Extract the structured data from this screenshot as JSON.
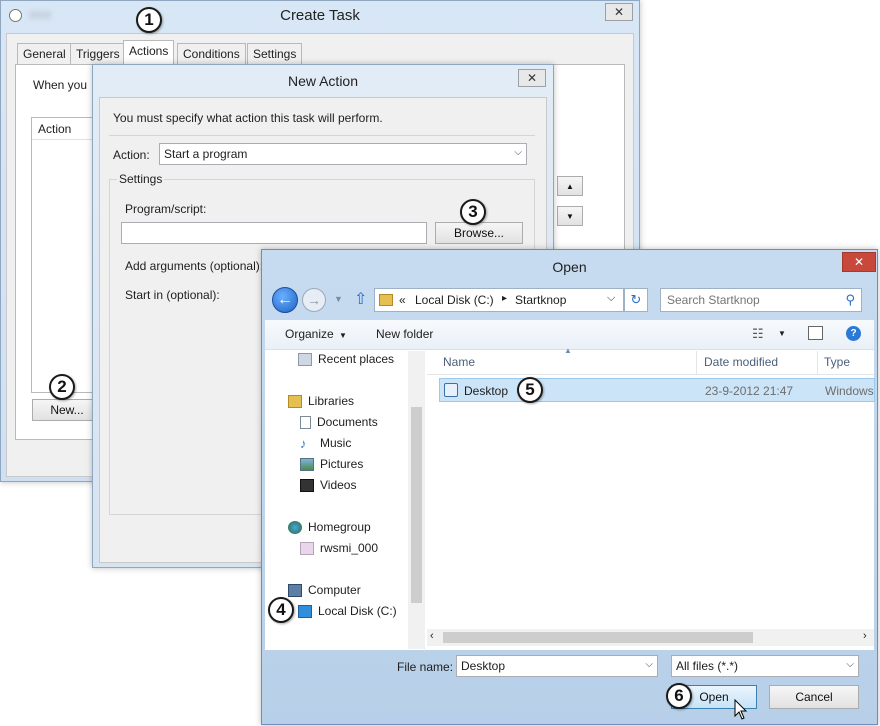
{
  "create_task": {
    "title": "Create Task",
    "close": "✕",
    "tabs": [
      "General",
      "Triggers",
      "Actions",
      "Conditions",
      "Settings"
    ],
    "intro_text": "When you",
    "column_action": "Action",
    "new_button": "New...",
    "up_arrow": "▲",
    "down_arrow": "▼"
  },
  "new_action": {
    "title": "New Action",
    "close": "✕",
    "instruction": "You must specify what action this task will perform.",
    "action_label": "Action:",
    "action_value": "Start a program",
    "settings_label": "Settings",
    "program_label": "Program/script:",
    "browse_button": "Browse...",
    "args_label": "Add arguments (optional):",
    "startin_label": "Start in (optional):"
  },
  "open_dialog": {
    "title": "Open",
    "close": "✕",
    "path_prefix": "«",
    "path_drive": "Local Disk (C:)",
    "path_sep": "▸",
    "path_folder": "Startknop",
    "search_placeholder": "Search Startknop",
    "organize": "Organize",
    "organize_arrow": "▼",
    "new_folder": "New folder",
    "nav": {
      "recent": "Recent places",
      "libraries": "Libraries",
      "documents": "Documents",
      "music": "Music",
      "pictures": "Pictures",
      "videos": "Videos",
      "homegroup": "Homegroup",
      "user": "rwsmi_000",
      "computer": "Computer",
      "local_disk": "Local Disk (C:)"
    },
    "columns": {
      "name": "Name",
      "date": "Date modified",
      "type": "Type"
    },
    "files": [
      {
        "name": "Desktop",
        "date": "23-9-2012 21:47",
        "type": "Windows"
      }
    ],
    "filename_label": "File name:",
    "filename_value": "Desktop",
    "filter_value": "All files (*.*)",
    "open_button": "Open",
    "cancel_button": "Cancel"
  },
  "badges": [
    "1",
    "2",
    "3",
    "4",
    "5",
    "6"
  ],
  "colors": {
    "accent_blue": "#2b79d6",
    "selection": "#cce4f7",
    "close_red": "#c9483c"
  }
}
